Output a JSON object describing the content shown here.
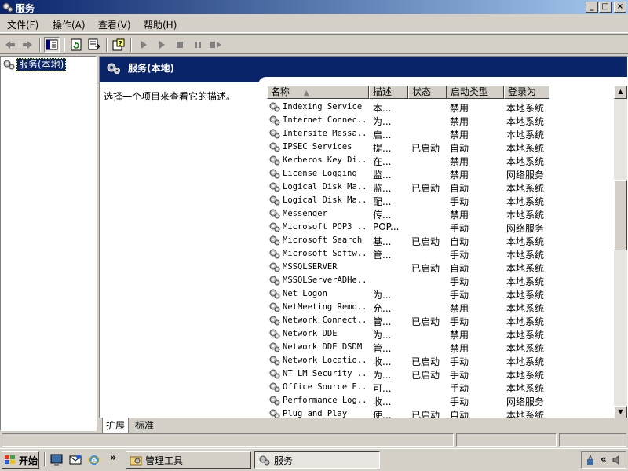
{
  "window": {
    "title": "服务"
  },
  "titlebar_buttons": {
    "minimize": "_",
    "maximize": "□",
    "close": "×"
  },
  "menu": [
    {
      "label": "文件(F)"
    },
    {
      "label": "操作(A)"
    },
    {
      "label": "查看(V)"
    },
    {
      "label": "帮助(H)"
    }
  ],
  "tree": {
    "root_label": "服务(本地)"
  },
  "pane": {
    "header_title": "服务(本地)",
    "description": "选择一个项目来查看它的描述。"
  },
  "columns": [
    {
      "label": "名称"
    },
    {
      "label": "描述"
    },
    {
      "label": "状态"
    },
    {
      "label": "启动类型"
    },
    {
      "label": "登录为"
    }
  ],
  "services": [
    {
      "name": "Indexing Service",
      "desc": "本...",
      "status": "",
      "startup": "禁用",
      "logon": "本地系统"
    },
    {
      "name": "Internet Connec...",
      "desc": "为...",
      "status": "",
      "startup": "禁用",
      "logon": "本地系统"
    },
    {
      "name": "Intersite Messa...",
      "desc": "启...",
      "status": "",
      "startup": "禁用",
      "logon": "本地系统"
    },
    {
      "name": "IPSEC Services",
      "desc": "提...",
      "status": "已启动",
      "startup": "自动",
      "logon": "本地系统"
    },
    {
      "name": "Kerberos Key Di...",
      "desc": "在...",
      "status": "",
      "startup": "禁用",
      "logon": "本地系统"
    },
    {
      "name": "License Logging",
      "desc": "监...",
      "status": "",
      "startup": "禁用",
      "logon": "网络服务"
    },
    {
      "name": "Logical Disk Ma...",
      "desc": "监...",
      "status": "已启动",
      "startup": "自动",
      "logon": "本地系统"
    },
    {
      "name": "Logical Disk Ma...",
      "desc": "配...",
      "status": "",
      "startup": "手动",
      "logon": "本地系统"
    },
    {
      "name": "Messenger",
      "desc": "传...",
      "status": "",
      "startup": "禁用",
      "logon": "本地系统"
    },
    {
      "name": "Microsoft POP3 ...",
      "desc": "POP...",
      "status": "",
      "startup": "手动",
      "logon": "网络服务"
    },
    {
      "name": "Microsoft Search",
      "desc": "基...",
      "status": "已启动",
      "startup": "自动",
      "logon": "本地系统"
    },
    {
      "name": "Microsoft Softw...",
      "desc": "管...",
      "status": "",
      "startup": "手动",
      "logon": "本地系统"
    },
    {
      "name": "MSSQLSERVER",
      "desc": "",
      "status": "已启动",
      "startup": "自动",
      "logon": "本地系统"
    },
    {
      "name": "MSSQLServerADHe...",
      "desc": "",
      "status": "",
      "startup": "手动",
      "logon": "本地系统"
    },
    {
      "name": "Net Logon",
      "desc": "为...",
      "status": "",
      "startup": "手动",
      "logon": "本地系统"
    },
    {
      "name": "NetMeeting Remo...",
      "desc": "允...",
      "status": "",
      "startup": "禁用",
      "logon": "本地系统"
    },
    {
      "name": "Network Connect...",
      "desc": "管...",
      "status": "已启动",
      "startup": "手动",
      "logon": "本地系统"
    },
    {
      "name": "Network DDE",
      "desc": "为...",
      "status": "",
      "startup": "禁用",
      "logon": "本地系统"
    },
    {
      "name": "Network DDE DSDM",
      "desc": "管...",
      "status": "",
      "startup": "禁用",
      "logon": "本地系统"
    },
    {
      "name": "Network Locatio...",
      "desc": "收...",
      "status": "已启动",
      "startup": "手动",
      "logon": "本地系统"
    },
    {
      "name": "NT LM Security ...",
      "desc": "为...",
      "status": "已启动",
      "startup": "手动",
      "logon": "本地系统"
    },
    {
      "name": "Office Source E...",
      "desc": "可...",
      "status": "",
      "startup": "手动",
      "logon": "本地系统"
    },
    {
      "name": "Performance Log...",
      "desc": "收...",
      "status": "",
      "startup": "手动",
      "logon": "网络服务"
    },
    {
      "name": "Plug and Play",
      "desc": "使...",
      "status": "已启动",
      "startup": "自动",
      "logon": "本地系统"
    }
  ],
  "tabs": [
    {
      "label": "扩展"
    },
    {
      "label": "标准"
    }
  ],
  "taskbar": {
    "start_label": "开始",
    "overflow": "»",
    "tasks": [
      {
        "label": "管理工具"
      },
      {
        "label": "服务"
      }
    ],
    "tray_chevron": "«"
  },
  "colors": {
    "title_start": "#0a246a",
    "title_end": "#a6caf0",
    "face": "#d4d0c8",
    "header": "#0a246a"
  }
}
